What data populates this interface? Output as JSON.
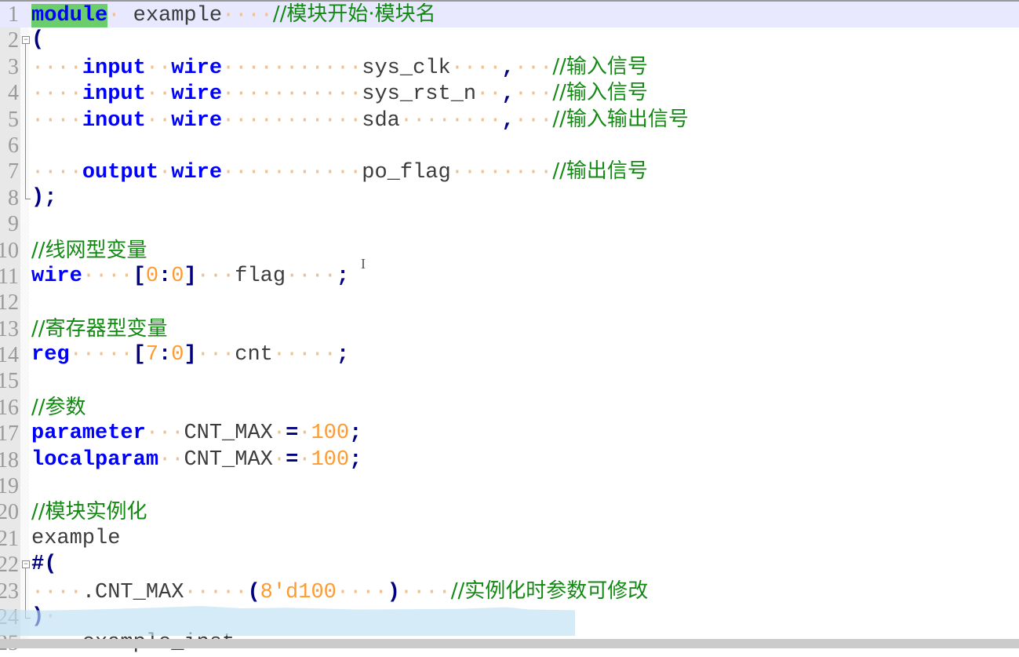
{
  "editor": {
    "language": "Verilog",
    "current_line": 1,
    "lines": [
      {
        "n": "1",
        "tokens": [
          [
            "kw hl",
            "module"
          ],
          [
            "ws",
            "·"
          ],
          [
            "id",
            " example"
          ],
          [
            "ws",
            "····"
          ],
          [
            "cm",
            "//模块开始·模块名"
          ]
        ]
      },
      {
        "n": "2",
        "tokens": [
          [
            "op",
            "("
          ]
        ]
      },
      {
        "n": "3",
        "tokens": [
          [
            "ws",
            "····"
          ],
          [
            "kw",
            "input"
          ],
          [
            "ws",
            "··"
          ],
          [
            "kw",
            "wire"
          ],
          [
            "ws",
            "···········"
          ],
          [
            "id",
            "sys_clk"
          ],
          [
            "ws",
            "····"
          ],
          [
            "op",
            ","
          ],
          [
            "ws",
            "···"
          ],
          [
            "cm",
            "//输入信号"
          ]
        ]
      },
      {
        "n": "4",
        "tokens": [
          [
            "ws",
            "····"
          ],
          [
            "kw",
            "input"
          ],
          [
            "ws",
            "··"
          ],
          [
            "kw",
            "wire"
          ],
          [
            "ws",
            "···········"
          ],
          [
            "id",
            "sys_rst_n"
          ],
          [
            "ws",
            "··"
          ],
          [
            "op",
            ","
          ],
          [
            "ws",
            "···"
          ],
          [
            "cm",
            "//输入信号"
          ]
        ]
      },
      {
        "n": "5",
        "tokens": [
          [
            "ws",
            "····"
          ],
          [
            "kw",
            "inout"
          ],
          [
            "ws",
            "··"
          ],
          [
            "kw",
            "wire"
          ],
          [
            "ws",
            "···········"
          ],
          [
            "id",
            "sda"
          ],
          [
            "ws",
            "········"
          ],
          [
            "op",
            ","
          ],
          [
            "ws",
            "···"
          ],
          [
            "cm",
            "//输入输出信号"
          ]
        ]
      },
      {
        "n": "6",
        "tokens": []
      },
      {
        "n": "7",
        "tokens": [
          [
            "ws",
            "····"
          ],
          [
            "kw",
            "output"
          ],
          [
            "ws",
            "·"
          ],
          [
            "kw",
            "wire"
          ],
          [
            "ws",
            "···········"
          ],
          [
            "id",
            "po_flag"
          ],
          [
            "ws",
            "········"
          ],
          [
            "cm",
            "//输出信号"
          ]
        ]
      },
      {
        "n": "8",
        "tokens": [
          [
            "op",
            ");"
          ]
        ]
      },
      {
        "n": "9",
        "tokens": []
      },
      {
        "n": "10",
        "tokens": [
          [
            "cm",
            "//线网型变量"
          ]
        ]
      },
      {
        "n": "11",
        "tokens": [
          [
            "kw",
            "wire"
          ],
          [
            "ws",
            "····"
          ],
          [
            "op",
            "["
          ],
          [
            "num",
            "0"
          ],
          [
            "op",
            ":"
          ],
          [
            "num",
            "0"
          ],
          [
            "op",
            "]"
          ],
          [
            "ws",
            "···"
          ],
          [
            "id",
            "flag"
          ],
          [
            "ws",
            "····"
          ],
          [
            "op",
            ";"
          ]
        ]
      },
      {
        "n": "12",
        "tokens": []
      },
      {
        "n": "13",
        "tokens": [
          [
            "cm",
            "//寄存器型变量"
          ]
        ]
      },
      {
        "n": "14",
        "tokens": [
          [
            "kw",
            "reg"
          ],
          [
            "ws",
            "·····"
          ],
          [
            "op",
            "["
          ],
          [
            "num",
            "7"
          ],
          [
            "op",
            ":"
          ],
          [
            "num",
            "0"
          ],
          [
            "op",
            "]"
          ],
          [
            "ws",
            "···"
          ],
          [
            "id",
            "cnt"
          ],
          [
            "ws",
            "·····"
          ],
          [
            "op",
            ";"
          ]
        ]
      },
      {
        "n": "15",
        "tokens": []
      },
      {
        "n": "16",
        "tokens": [
          [
            "cm",
            "//参数"
          ]
        ]
      },
      {
        "n": "17",
        "tokens": [
          [
            "kw",
            "parameter"
          ],
          [
            "ws",
            "···"
          ],
          [
            "id",
            "CNT_MAX"
          ],
          [
            "ws",
            "·"
          ],
          [
            "op",
            "="
          ],
          [
            "ws",
            "·"
          ],
          [
            "num",
            "100"
          ],
          [
            "op",
            ";"
          ]
        ]
      },
      {
        "n": "18",
        "tokens": [
          [
            "kw",
            "localparam"
          ],
          [
            "ws",
            "··"
          ],
          [
            "id",
            "CNT_MAX"
          ],
          [
            "ws",
            "·"
          ],
          [
            "op",
            "="
          ],
          [
            "ws",
            "·"
          ],
          [
            "num",
            "100"
          ],
          [
            "op",
            ";"
          ]
        ]
      },
      {
        "n": "19",
        "tokens": []
      },
      {
        "n": "20",
        "tokens": [
          [
            "cm",
            "//模块实例化"
          ]
        ]
      },
      {
        "n": "21",
        "tokens": [
          [
            "id",
            "example"
          ]
        ]
      },
      {
        "n": "22",
        "tokens": [
          [
            "op",
            "#("
          ]
        ]
      },
      {
        "n": "23",
        "tokens": [
          [
            "ws",
            "····"
          ],
          [
            "id",
            ".CNT_MAX"
          ],
          [
            "ws",
            "·····"
          ],
          [
            "op",
            "("
          ],
          [
            "num",
            "8'd100"
          ],
          [
            "ws",
            "····"
          ],
          [
            "op",
            ")"
          ],
          [
            "ws",
            "····"
          ],
          [
            "cm",
            "//实例化时参数可修改"
          ]
        ]
      },
      {
        "n": "24",
        "tokens": [
          [
            "op",
            ")"
          ],
          [
            "ws",
            "·"
          ]
        ]
      },
      {
        "n": "25",
        "tokens": [
          [
            "ws",
            "····"
          ],
          [
            "id",
            "example_inst"
          ]
        ]
      }
    ]
  }
}
